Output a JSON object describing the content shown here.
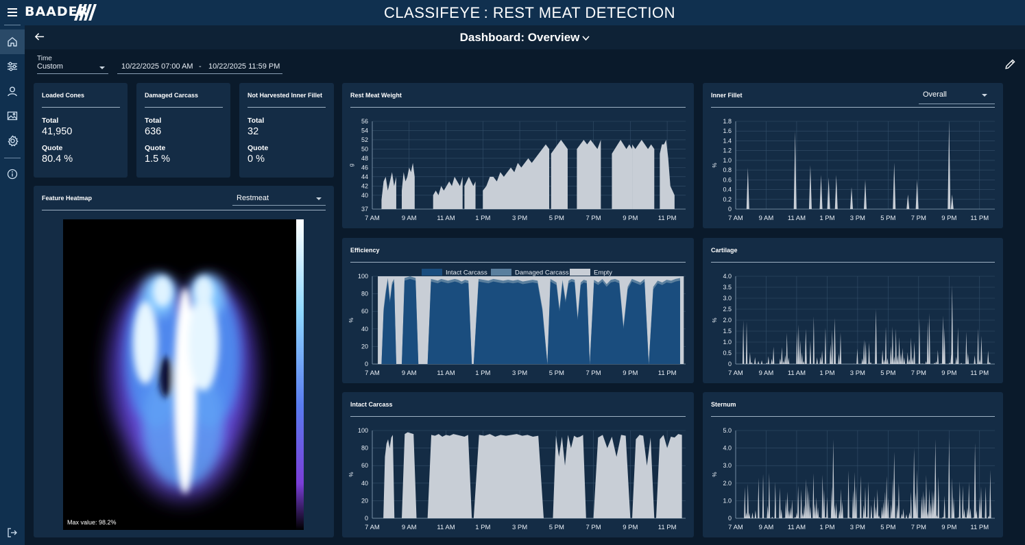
{
  "header": {
    "brand": "BAADER",
    "app_title": "CLASSIFEYE : REST MEAT DETECTION"
  },
  "subheader": {
    "dashboard_title": "Dashboard: Overview"
  },
  "filters": {
    "time_label": "Time",
    "time_value": "Custom",
    "date_from": "10/22/2025 07:00 AM",
    "date_separator": "-",
    "date_to": "10/22/2025 11:59 PM"
  },
  "kpis": [
    {
      "title": "Loaded Cones",
      "total_label": "Total",
      "total": "41,950",
      "quote_label": "Quote",
      "quote": "80.4 %"
    },
    {
      "title": "Damaged Carcass",
      "total_label": "Total",
      "total": "636",
      "quote_label": "Quote",
      "quote": "1.5 %"
    },
    {
      "title": "Not Harvested Inner Fillet",
      "total_label": "Total",
      "total": "32",
      "quote_label": "Quote",
      "quote": "0 %"
    }
  ],
  "heatmap": {
    "title": "Feature Heatmap",
    "select_value": "Restmeat",
    "max_label": "Max value: 98.2%"
  },
  "inner_fillet_select": "Overall",
  "colors": {
    "background": "#0a1a2b",
    "bar": "#10304f",
    "card": "#142c45",
    "fill_light": "#c8ced6",
    "intact": "#1a4d7e",
    "damaged": "#5a7f9e"
  },
  "chart_data": [
    {
      "id": "rest_meat_weight",
      "title": "Rest Meat Weight",
      "type": "area",
      "ylabel": "g",
      "yticks": [
        "37",
        "40",
        "42",
        "44",
        "46",
        "48",
        "50",
        "52",
        "54",
        "56"
      ],
      "ylim": [
        37,
        56
      ],
      "xticks": [
        "7 AM",
        "9 AM",
        "11 AM",
        "1 PM",
        "3 PM",
        "5 PM",
        "7 PM",
        "9 PM",
        "11 PM"
      ],
      "segments": [
        {
          "x": [
            7.5,
            8.3
          ],
          "values": [
            39,
            43,
            44,
            41,
            43,
            45,
            42,
            44
          ]
        },
        {
          "x": [
            8.6,
            9.3
          ],
          "values": [
            41,
            45,
            43,
            44,
            46,
            45,
            47,
            44
          ]
        },
        {
          "x": [
            10.3,
            11.9
          ],
          "values": [
            40,
            41,
            40,
            42,
            41,
            42,
            43,
            42,
            44,
            43,
            42,
            44
          ]
        },
        {
          "x": [
            12.0,
            12.6
          ],
          "values": [
            42,
            43,
            44,
            43,
            42,
            43
          ]
        },
        {
          "x": [
            13.0,
            16.6
          ],
          "values": [
            41,
            42,
            44,
            44,
            43,
            45,
            44,
            45,
            46,
            45,
            47,
            46,
            47,
            48,
            47,
            48,
            49,
            50,
            51,
            50
          ]
        },
        {
          "x": [
            16.7,
            17.6
          ],
          "values": [
            49,
            50,
            51,
            52,
            51,
            50
          ]
        },
        {
          "x": [
            18.1,
            19.4
          ],
          "values": [
            50,
            51,
            52,
            51,
            52,
            51,
            50,
            52
          ]
        },
        {
          "x": [
            20.0,
            21.1
          ],
          "values": [
            49,
            50,
            51,
            52,
            51,
            50,
            51,
            50
          ]
        },
        {
          "x": [
            21.1,
            22.3
          ],
          "values": [
            51,
            50,
            51,
            52,
            51,
            50,
            51,
            50
          ]
        },
        {
          "x": [
            22.6,
            23.4
          ],
          "values": [
            49,
            51,
            51,
            52,
            48,
            42,
            41,
            40
          ]
        }
      ]
    },
    {
      "id": "inner_fillet",
      "title": "Inner Fillet",
      "type": "area",
      "ylabel": "%",
      "yticks": [
        "0",
        "0.2",
        "0.4",
        "0.6",
        "0.8",
        "1.0",
        "1.2",
        "1.4",
        "1.6",
        "1.8"
      ],
      "ylim": [
        0,
        1.8
      ],
      "xticks": [
        "7 AM",
        "9 AM",
        "11 AM",
        "1 PM",
        "3 PM",
        "5 PM",
        "7 PM",
        "9 PM",
        "11 PM"
      ],
      "spikes": [
        [
          7.8,
          0.85
        ],
        [
          10.9,
          1.6
        ],
        [
          11.9,
          0.9
        ],
        [
          12.6,
          0.7
        ],
        [
          13.1,
          0.65
        ],
        [
          13.6,
          0.7
        ],
        [
          14.6,
          0.45
        ],
        [
          15.5,
          0.6
        ],
        [
          17.4,
          0.95
        ],
        [
          18.3,
          0.3
        ],
        [
          18.9,
          0.6
        ],
        [
          21.0,
          1.8
        ],
        [
          21.2,
          0.3
        ]
      ]
    },
    {
      "id": "efficiency",
      "title": "Efficiency",
      "type": "area",
      "ylabel": "%",
      "legend": [
        "Intact Carcass",
        "Damaged Carcass",
        "Empty"
      ],
      "yticks": [
        "0",
        "20",
        "40",
        "60",
        "80",
        "100"
      ],
      "ylim": [
        0,
        100
      ],
      "xticks": [
        "7 AM",
        "9 AM",
        "11 AM",
        "1 PM",
        "3 PM",
        "5 PM",
        "7 PM",
        "9 PM",
        "11 PM"
      ],
      "segments": [
        {
          "x": [
            7.5,
            8.3
          ],
          "values": [
            0,
            60,
            80,
            95,
            70,
            90,
            94,
            0
          ]
        },
        {
          "x": [
            8.6,
            9.5
          ],
          "values": [
            0,
            95,
            96,
            97,
            96,
            95,
            0
          ]
        },
        {
          "x": [
            10.0,
            12.4
          ],
          "values": [
            0,
            94,
            93,
            92,
            94,
            93,
            92,
            93,
            94,
            93,
            91,
            93,
            92,
            0
          ]
        },
        {
          "x": [
            12.5,
            16.5
          ],
          "values": [
            0,
            94,
            93,
            92,
            94,
            93,
            92,
            93,
            92,
            93,
            91,
            92,
            93,
            92,
            60,
            0
          ]
        },
        {
          "x": [
            16.5,
            18.8
          ],
          "values": [
            0,
            94,
            92,
            90,
            60,
            93,
            70,
            92,
            94,
            93,
            50,
            90,
            93,
            92,
            0
          ]
        },
        {
          "x": [
            18.8,
            22.0
          ],
          "values": [
            0,
            93,
            90,
            94,
            88,
            93,
            94,
            92,
            40,
            85,
            94,
            92,
            90,
            94,
            0
          ]
        },
        {
          "x": [
            22.0,
            23.7
          ],
          "values": [
            0,
            85,
            92,
            90,
            93,
            92,
            94,
            95
          ]
        }
      ]
    },
    {
      "id": "cartilage",
      "title": "Cartilage",
      "type": "area",
      "ylabel": "%",
      "yticks": [
        "0",
        "0.5",
        "1.0",
        "1.5",
        "2.0",
        "2.5",
        "3.0",
        "3.5",
        "4.0"
      ],
      "ylim": [
        0,
        4.0
      ],
      "xticks": [
        "7 AM",
        "9 AM",
        "11 AM",
        "1 PM",
        "3 PM",
        "5 PM",
        "7 PM",
        "9 PM",
        "11 PM"
      ]
    },
    {
      "id": "intact_carcass",
      "title": "Intact Carcass",
      "type": "area",
      "ylabel": "%",
      "yticks": [
        "0",
        "20",
        "40",
        "60",
        "80",
        "100"
      ],
      "ylim": [
        0,
        100
      ],
      "xticks": [
        "7 AM",
        "9 AM",
        "11 AM",
        "1 PM",
        "3 PM",
        "5 PM",
        "7 PM",
        "9 PM",
        "11 PM"
      ],
      "segments": [
        {
          "x": [
            7.6,
            8.2
          ],
          "values": [
            0,
            70,
            85,
            90,
            80,
            92,
            95,
            0
          ]
        },
        {
          "x": [
            8.6,
            9.4
          ],
          "values": [
            0,
            96,
            98,
            97,
            96,
            0
          ]
        },
        {
          "x": [
            10.0,
            12.4
          ],
          "values": [
            0,
            95,
            94,
            96,
            93,
            95,
            94,
            96,
            95,
            94,
            93,
            95,
            0
          ]
        },
        {
          "x": [
            12.5,
            16.3
          ],
          "values": [
            0,
            95,
            94,
            96,
            93,
            95,
            94,
            95,
            96,
            94,
            95,
            93,
            94,
            0
          ]
        },
        {
          "x": [
            16.8,
            18.6
          ],
          "values": [
            0,
            94,
            70,
            93,
            60,
            95,
            80,
            94,
            92,
            93,
            95,
            0
          ]
        },
        {
          "x": [
            19.0,
            21.0
          ],
          "values": [
            0,
            92,
            95,
            80,
            93,
            70,
            95,
            94,
            0
          ]
        },
        {
          "x": [
            21.1,
            22.3
          ],
          "values": [
            0,
            90,
            95,
            94,
            60,
            92,
            0
          ]
        },
        {
          "x": [
            22.4,
            23.8
          ],
          "values": [
            0,
            90,
            95,
            80,
            93,
            92,
            96,
            95
          ]
        }
      ]
    },
    {
      "id": "sternum",
      "title": "Sternum",
      "type": "area",
      "ylabel": "%",
      "yticks": [
        "0",
        "1.0",
        "2.0",
        "3.0",
        "4.0",
        "5.0"
      ],
      "ylim": [
        0,
        5.0
      ],
      "xticks": [
        "7 AM",
        "9 AM",
        "11 AM",
        "1 PM",
        "3 PM",
        "5 PM",
        "7 PM",
        "9 PM",
        "11 PM"
      ]
    }
  ]
}
